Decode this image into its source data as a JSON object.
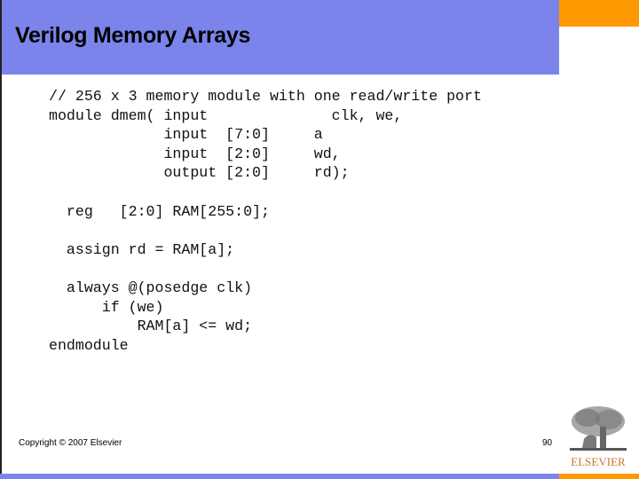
{
  "slide": {
    "title": "Verilog Memory Arrays",
    "code_lines": [
      "// 256 x 3 memory module with one read/write port",
      "module dmem( input              clk, we,",
      "             input  [7:0]     a",
      "             input  [2:0]     wd,",
      "             output [2:0]     rd);",
      "",
      "  reg   [2:0] RAM[255:0];",
      "",
      "  assign rd = RAM[a];",
      "",
      "  always @(posedge clk)",
      "      if (we)",
      "          RAM[a] <= wd;",
      "endmodule"
    ],
    "footer": {
      "copyright": "Copyright © 2007 Elsevier",
      "page_number": "90",
      "logo_text": "ELSEVIER"
    }
  },
  "colors": {
    "header_blue": "#7b84ea",
    "accent_orange": "#ff9900",
    "logo_text": "#c8782a"
  }
}
